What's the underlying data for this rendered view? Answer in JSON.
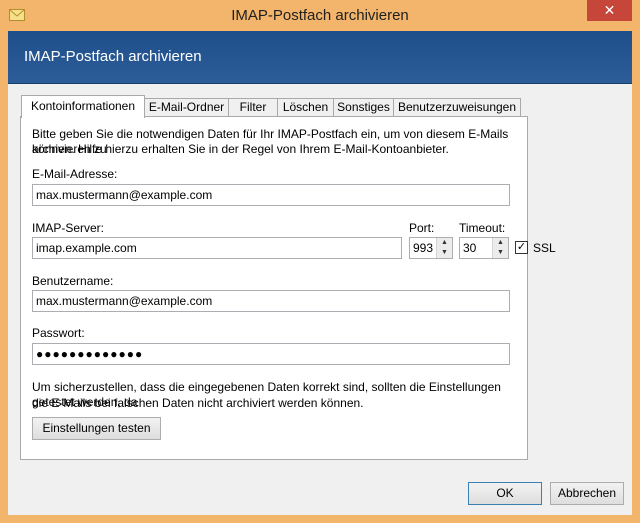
{
  "window": {
    "title": "IMAP-Postfach archivieren",
    "close_label": "✕"
  },
  "header": {
    "title": "IMAP-Postfach archivieren"
  },
  "tabs": [
    {
      "label": "Kontoinformationen",
      "active": true
    },
    {
      "label": "E-Mail-Ordner"
    },
    {
      "label": "Filter"
    },
    {
      "label": "Löschen"
    },
    {
      "label": "Sonstiges"
    },
    {
      "label": "Benutzerzuweisungen"
    }
  ],
  "form": {
    "intro_line1": "Bitte geben Sie die notwendigen Daten für Ihr IMAP-Postfach ein, um von diesem E-Mails archivieren zu",
    "intro_line2": "können. Hilfe hierzu erhalten Sie in der Regel von Ihrem E-Mail-Kontoanbieter.",
    "email_label": "E-Mail-Adresse:",
    "email_value": "max.mustermann@example.com",
    "server_label": "IMAP-Server:",
    "server_value": "imap.example.com",
    "port_label": "Port:",
    "port_value": "993",
    "timeout_label": "Timeout:",
    "timeout_value": "30",
    "ssl_label": "SSL",
    "ssl_checked": true,
    "check_mark": "✓",
    "username_label": "Benutzername:",
    "username_value": "max.mustermann@example.com",
    "password_label": "Passwort:",
    "password_value": "●●●●●●●●●●●●●",
    "note_line1": "Um sicherzustellen, dass die eingegebenen Daten korrekt sind, sollten die Einstellungen getestet werden, da",
    "note_line2": "die E-Mails bei falschen Daten nicht archiviert werden können.",
    "test_button": "Einstellungen testen"
  },
  "footer": {
    "ok_label": "OK",
    "cancel_label": "Abbrechen"
  },
  "colors": {
    "banner": "#1f4f8a",
    "close": "#c7463a",
    "frame": "#f3b56c"
  }
}
